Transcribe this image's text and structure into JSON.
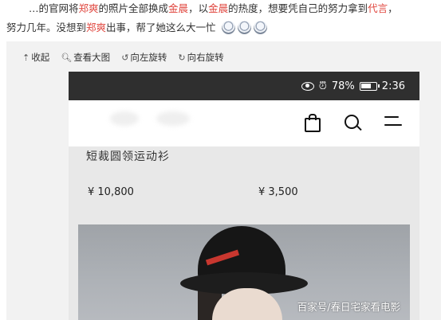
{
  "post": {
    "line1_prefix": "…的官网将",
    "name1": "郑爽",
    "line1_mid": "的照片全部换成",
    "name2": "金晨",
    "line1_mid2": "，以",
    "name3": "金晨",
    "line1_mid3": "的热度，想要凭自己的努力拿到",
    "name4": "代言",
    "line1_end": "，",
    "line2_prefix": "努力几年。没想到",
    "name5": "郑爽",
    "line2_end": "出事，帮了她这么大一忙"
  },
  "toolbar": {
    "collapse": "收起",
    "view_large": "查看大图",
    "rotate_left": "向左旋转",
    "rotate_right": "向右旋转"
  },
  "phone": {
    "status": {
      "battery_percent": "78%",
      "time": "2:36"
    },
    "product_title": "短裁圆领运动衫",
    "prices": [
      "¥ 10,800",
      "¥ 3,500"
    ],
    "watermark": "百家号/春日宅家看电影"
  }
}
